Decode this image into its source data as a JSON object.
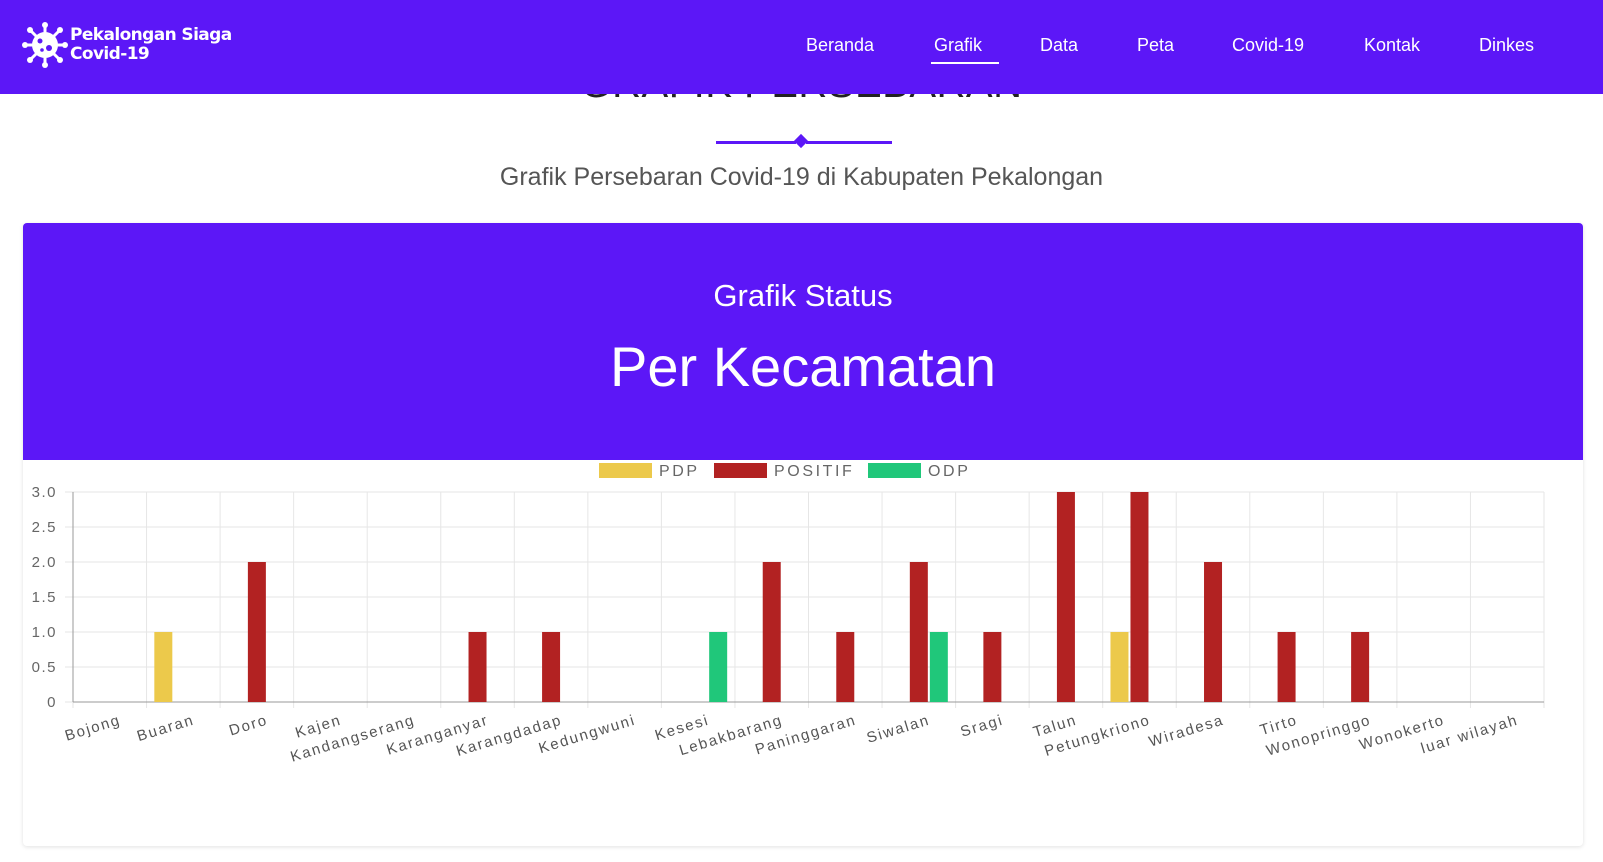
{
  "brand": {
    "line1": "Pekalongan Siaga",
    "line2": "Covid-19",
    "logo_icon": "virus-icon"
  },
  "nav": {
    "items": [
      {
        "label": "Beranda",
        "active": false
      },
      {
        "label": "Grafik",
        "active": true
      },
      {
        "label": "Data",
        "active": false
      },
      {
        "label": "Peta",
        "active": false
      },
      {
        "label": "Covid-19",
        "active": false
      },
      {
        "label": "Kontak",
        "active": false
      },
      {
        "label": "Dinkes",
        "active": false
      }
    ]
  },
  "section": {
    "title": "GRAFIK PERSEBARAN",
    "subtitle": "Grafik Persebaran Covid-19 di Kabupaten Pekalongan"
  },
  "card": {
    "subtitle": "Grafik Status",
    "title": "Per Kecamatan"
  },
  "colors": {
    "primary": "#5c17f7",
    "pdp": "#ecc94b",
    "positif": "#b22222",
    "odp": "#20c77a"
  },
  "chart_data": {
    "type": "bar",
    "categories": [
      "Bojong",
      "Buaran",
      "Doro",
      "Kajen",
      "Kandangserang",
      "Karanganyar",
      "Karangdadap",
      "Kedungwuni",
      "Kesesi",
      "Lebakbarang",
      "Paninggaran",
      "Siwalan",
      "Sragi",
      "Talun",
      "Petungkriono",
      "Wiradesa",
      "Tirto",
      "Wonopringgo",
      "Wonokerto",
      "luar wilayah"
    ],
    "series": [
      {
        "name": "PDP",
        "values": [
          0,
          1,
          0,
          0,
          0,
          0,
          0,
          0,
          0,
          0,
          0,
          0,
          0,
          0,
          1,
          0,
          0,
          0,
          0,
          0
        ]
      },
      {
        "name": "POSITIF",
        "values": [
          0,
          0,
          2,
          0,
          0,
          1,
          1,
          0,
          0,
          2,
          1,
          2,
          1,
          3,
          3,
          2,
          1,
          1,
          0,
          0
        ]
      },
      {
        "name": "ODP",
        "values": [
          0,
          0,
          0,
          0,
          0,
          0,
          0,
          0,
          1,
          0,
          0,
          1,
          0,
          0,
          0,
          0,
          0,
          0,
          0,
          0
        ]
      }
    ],
    "yticks": [
      "0",
      "0.5",
      "1.0",
      "1.5",
      "2.0",
      "2.5",
      "3.0"
    ],
    "ylim": [
      0,
      3
    ],
    "grid": true,
    "legend": "top-center"
  }
}
